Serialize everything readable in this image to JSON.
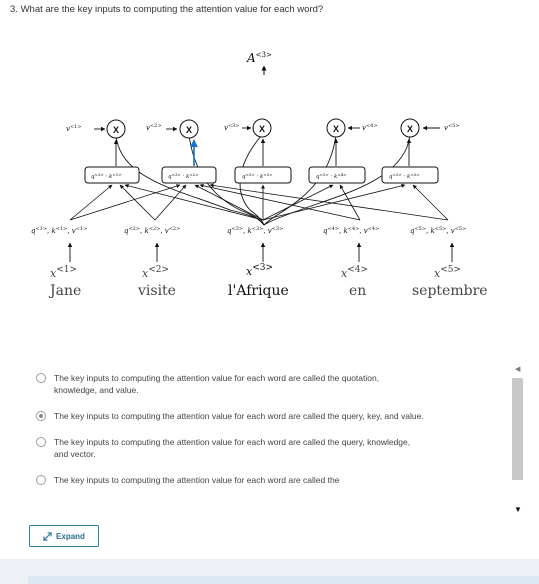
{
  "question": {
    "number": "3.",
    "text": "What are the key inputs to computing the attention value for each word?"
  },
  "diagram": {
    "attention_label": {
      "base": "A",
      "sup": "<3>"
    },
    "value_labels": [
      {
        "base": "v",
        "sup": "<1>"
      },
      {
        "base": "v",
        "sup": "<2>"
      },
      {
        "base": "v",
        "sup": "<3>"
      },
      {
        "base": "v",
        "sup": "<4>"
      },
      {
        "base": "v",
        "sup": "<5>"
      }
    ],
    "multiply_symbol": "X",
    "dot_products": [
      {
        "q": "q",
        "qs": "<3>",
        "dot": " · ",
        "k": "k",
        "ks": "<1>"
      },
      {
        "q": "q",
        "qs": "<3>",
        "dot": " · ",
        "k": "k",
        "ks": "<2>"
      },
      {
        "q": "q",
        "qs": "<3>",
        "dot": " · ",
        "k": "k",
        "ks": "<3>"
      },
      {
        "q": "q",
        "qs": "<3>",
        "dot": " · ",
        "k": "k",
        "ks": "<4>"
      },
      {
        "q": "q",
        "qs": "<3>",
        "dot": " · ",
        "k": "k",
        "ks": "<5>"
      }
    ],
    "qkv_labels": [
      {
        "q": "q",
        "k": "k",
        "v": "v",
        "sup": "<1>"
      },
      {
        "q": "q",
        "k": "k",
        "v": "v",
        "sup": "<2>"
      },
      {
        "q": "q",
        "k": "k",
        "v": "v",
        "sup": "<3>"
      },
      {
        "q": "q",
        "k": "k",
        "v": "v",
        "sup": "<4>"
      },
      {
        "q": "q",
        "k": "k",
        "v": "v",
        "sup": "<5>"
      }
    ],
    "x_labels": [
      {
        "base": "x",
        "sup": "<1>"
      },
      {
        "base": "x",
        "sup": "<2>"
      },
      {
        "base": "x",
        "sup": "<3>"
      },
      {
        "base": "x",
        "sup": "<4>"
      },
      {
        "base": "x",
        "sup": "<5>"
      }
    ],
    "words": [
      "Jane",
      "visite",
      "l'Afrique",
      "en",
      "septembre"
    ]
  },
  "options": [
    {
      "text": "The key inputs to computing the attention value for each word are called the quotation, knowledge, and value.",
      "checked": false
    },
    {
      "text": "The key inputs to computing the attention value for each word are called the query, key, and value.",
      "checked": true
    },
    {
      "text": "The key inputs to computing the attention value for each word are called the query, knowledge, and vector.",
      "checked": false
    },
    {
      "text": "The key inputs to computing the attention value for each word are called the",
      "checked": false
    }
  ],
  "expand": {
    "label": "Expand",
    "icon": "expand-icon"
  },
  "scroll": {
    "up_icon": "scroll-up-icon",
    "down_icon": "scroll-down-icon"
  },
  "colors": {
    "highlight_arrow": "#1a73c7",
    "button_border": "#2e7d9a"
  }
}
